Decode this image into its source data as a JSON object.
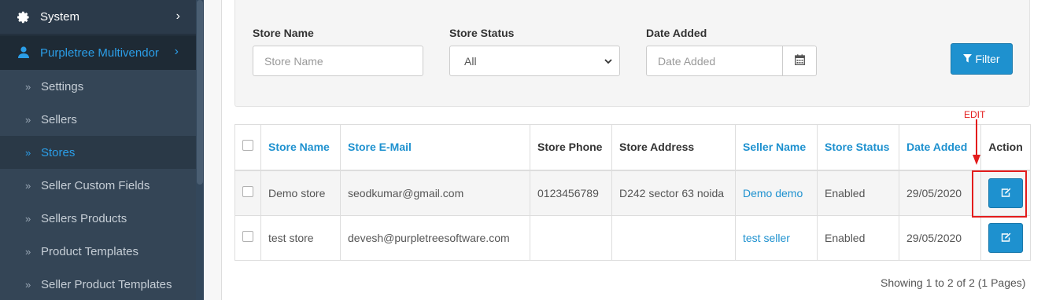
{
  "sidebar": {
    "system": {
      "label": "System",
      "icon": "gear-icon"
    },
    "purpletree": {
      "label": "Purpletree Multivendor",
      "icon": "user-icon"
    },
    "items": [
      {
        "label": "Settings"
      },
      {
        "label": "Sellers"
      },
      {
        "label": "Stores",
        "active": true
      },
      {
        "label": "Seller Custom Fields"
      },
      {
        "label": "Sellers Products"
      },
      {
        "label": "Product Templates"
      },
      {
        "label": "Seller Product Templates"
      }
    ]
  },
  "filter": {
    "store_name_label": "Store Name",
    "store_name_placeholder": "Store Name",
    "store_status_label": "Store Status",
    "store_status_value": "All",
    "date_added_label": "Date Added",
    "date_added_placeholder": "Date Added",
    "filter_button": "Filter"
  },
  "table": {
    "headers": {
      "store_name": "Store Name",
      "store_email": "Store E-Mail",
      "store_phone": "Store Phone",
      "store_address": "Store Address",
      "seller_name": "Seller Name",
      "store_status": "Store Status",
      "date_added": "Date Added",
      "action": "Action"
    },
    "rows": [
      {
        "store_name": "Demo store",
        "email": "seodkumar@gmail.com",
        "phone": "0123456789",
        "address": "D242 sector 63 noida",
        "seller": "Demo demo",
        "status": "Enabled",
        "date": "29/05/2020"
      },
      {
        "store_name": "test store",
        "email": "devesh@purpletreesoftware.com",
        "phone": "",
        "address": "",
        "seller": "test seller",
        "status": "Enabled",
        "date": "29/05/2020"
      }
    ]
  },
  "annotation": {
    "label": "EDIT",
    "color": "#e31c1c"
  },
  "pagination": {
    "text": "Showing 1 to 2 of 2 (1 Pages)"
  },
  "colors": {
    "sidebar_bg": "#2b3a4a",
    "accent": "#1e91cf",
    "active_text": "#2b9ee8"
  }
}
